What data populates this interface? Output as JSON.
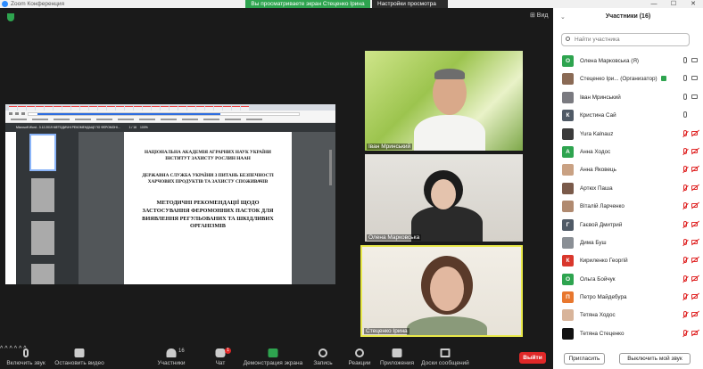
{
  "titlebar": {
    "app_title": "Zoom Конференция",
    "share_banner": "Вы просматриваете экран Стеценко Ірина",
    "view_options": "Настройки просмотра",
    "minimize": "—",
    "maximize": "☐",
    "close": "✕"
  },
  "stage": {
    "view_label": "⊞ Вид"
  },
  "shared_screen": {
    "doc_tab": "Microsoft Word - 3.12.2019 МЕТОДИЧНІ РЕКОМЕНДАЦІЇ ПО ФЕРОМОНІ...",
    "page_counter": "1 / 16",
    "zoom": "100%",
    "lines_small": [
      "НАЦІОНАЛЬНА АКАДЕМІЯ АГРАРНИХ НАУК УКРАЇНИ",
      "ІНСТИТУТ ЗАХИСТУ РОСЛИН НААН",
      "ДЕРЖАВНА СЛУЖБА УКРАЇНИ З ПИТАНЬ БЕЗПЕЧНОСТІ",
      "ХАРЧОВИХ ПРОДУКТІВ ТА ЗАХИСТУ СПОЖИВАЧІВ"
    ],
    "lines_big": [
      "МЕТОДИЧНІ РЕКОМЕНДАЦІЇ ЩОДО",
      "ЗАСТОСУВАННЯ ФЕРОМОННИХ ПАСТОК ДЛЯ",
      "ВИЯВЛЕННЯ РЕГУЛЬОВАНИХ ТА ШКІДЛИВИХ",
      "ОРГАНІЗМІВ"
    ]
  },
  "videos": [
    {
      "name": "Іван Мринський"
    },
    {
      "name": "Олена Марковська"
    },
    {
      "name": "Стеценко Ірина"
    }
  ],
  "panel": {
    "title": "Участники (16)",
    "collapse": "⌄",
    "search_placeholder": "Найти участника",
    "invite": "Пригласить",
    "mute_all": "Выключить мой звук",
    "participants": [
      {
        "name": "Олена Марковська (Я)",
        "initial": "О",
        "color": "#2ea44f",
        "mic": "on",
        "cam": "on",
        "host": false
      },
      {
        "name": "Стеценко Іри...  (Организатор)",
        "initial": "",
        "color": "#8a6a55",
        "mic": "on",
        "cam": "on",
        "host": true
      },
      {
        "name": "Іван Мринський",
        "initial": "",
        "color": "#7a7a80",
        "mic": "on",
        "cam": "on",
        "host": false
      },
      {
        "name": "Кристина Сай",
        "initial": "К",
        "color": "#505a66",
        "mic": "on",
        "cam": "none",
        "host": false
      },
      {
        "name": "Yura Kalnauz",
        "initial": "",
        "color": "#3a3a3a",
        "mic": "muted",
        "cam": "off",
        "host": false
      },
      {
        "name": "Анна Ходос",
        "initial": "А",
        "color": "#2ea44f",
        "mic": "muted",
        "cam": "off",
        "host": false
      },
      {
        "name": "Анна Яковець",
        "initial": "",
        "color": "#c9a183",
        "mic": "muted",
        "cam": "off",
        "host": false
      },
      {
        "name": "Артюх Паша",
        "initial": "",
        "color": "#7a5a4a",
        "mic": "muted",
        "cam": "off",
        "host": false
      },
      {
        "name": "Віталій Ларченко",
        "initial": "",
        "color": "#b08a70",
        "mic": "muted",
        "cam": "off",
        "host": false
      },
      {
        "name": "Гаєвой Дмитрий",
        "initial": "Г",
        "color": "#505a66",
        "mic": "muted",
        "cam": "off",
        "host": false
      },
      {
        "name": "Дима Буш",
        "initial": "",
        "color": "#8a8f95",
        "mic": "muted",
        "cam": "off",
        "host": false
      },
      {
        "name": "Кириленко Георгій",
        "initial": "К",
        "color": "#d9372c",
        "mic": "muted",
        "cam": "off",
        "host": false
      },
      {
        "name": "Ольга Бойчук",
        "initial": "О",
        "color": "#2ea44f",
        "mic": "muted",
        "cam": "off",
        "host": false
      },
      {
        "name": "Петро Майдебура",
        "initial": "П",
        "color": "#e8772e",
        "mic": "muted",
        "cam": "off",
        "host": false
      },
      {
        "name": "Тетяна Ходос",
        "initial": "",
        "color": "#d8b49a",
        "mic": "muted",
        "cam": "off",
        "host": false
      },
      {
        "name": "Тетяна Стеценко",
        "initial": "",
        "color": "#111111",
        "mic": "muted",
        "cam": "off",
        "host": false
      }
    ]
  },
  "toolbar": {
    "mute": "Включить звук",
    "video": "Остановить видео",
    "participants": "Участники",
    "participants_count": "16",
    "chat": "Чат",
    "chat_badge": "1",
    "share": "Демонстрация экрана",
    "record": "Запись",
    "reactions": "Реакции",
    "apps": "Приложения",
    "whiteboard": "Доски сообщений",
    "leave": "Выйти"
  }
}
